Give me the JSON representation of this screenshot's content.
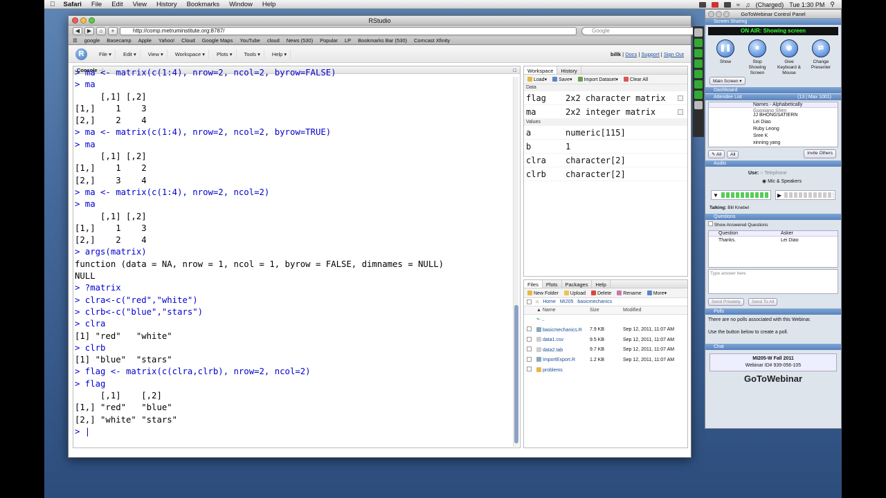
{
  "menubar": {
    "apple": "",
    "app": "Safari",
    "items": [
      "File",
      "Edit",
      "View",
      "History",
      "Bookmarks",
      "Window",
      "Help"
    ],
    "battery": "(Charged)",
    "clock": "Tue 1:30 PM"
  },
  "safari": {
    "title": "RStudio",
    "url": "http://comp.metruminstitute.org:8787/",
    "search_placeholder": "Google",
    "bookmarks": [
      "google",
      "Basecamp",
      "Apple",
      "Yahoo!",
      "Cloud",
      "Google Maps",
      "YouTube",
      "cloud",
      "News (530)",
      "Popular",
      "LP",
      "Bookmarks Bar (530)",
      "Comcast Xfinity"
    ]
  },
  "rstudio": {
    "logo": "R",
    "menus": [
      "File",
      "Edit",
      "View",
      "Workspace",
      "Plots",
      "Tools",
      "Help"
    ],
    "user": "billk",
    "links": [
      "Docs",
      "Support",
      "Sign Out"
    ],
    "console": {
      "title": "Console",
      "path": "~/",
      "lines": [
        {
          "t": "> ma <- matrix(c(1:4), nrow=2, ncol=2, byrow=FALSE)",
          "k": "cmd"
        },
        {
          "t": "> ma",
          "k": "cmd"
        },
        {
          "t": "     [,1] [,2]",
          "k": "out"
        },
        {
          "t": "[1,]    1    3",
          "k": "out"
        },
        {
          "t": "[2,]    2    4",
          "k": "out"
        },
        {
          "t": "> ma <- matrix(c(1:4), nrow=2, ncol=2, byrow=TRUE)",
          "k": "cmd"
        },
        {
          "t": "> ma",
          "k": "cmd"
        },
        {
          "t": "     [,1] [,2]",
          "k": "out"
        },
        {
          "t": "[1,]    1    2",
          "k": "out"
        },
        {
          "t": "[2,]    3    4",
          "k": "out"
        },
        {
          "t": "> ma <- matrix(c(1:4), nrow=2, ncol=2)",
          "k": "cmd"
        },
        {
          "t": "> ma",
          "k": "cmd"
        },
        {
          "t": "     [,1] [,2]",
          "k": "out"
        },
        {
          "t": "[1,]    1    3",
          "k": "out"
        },
        {
          "t": "[2,]    2    4",
          "k": "out"
        },
        {
          "t": "> args(matrix)",
          "k": "cmd"
        },
        {
          "t": "function (data = NA, nrow = 1, ncol = 1, byrow = FALSE, dimnames = NULL)",
          "k": "out"
        },
        {
          "t": "NULL",
          "k": "out"
        },
        {
          "t": "> ?matrix",
          "k": "cmd"
        },
        {
          "t": "> clra<-c(\"red\",\"white\")",
          "k": "cmd"
        },
        {
          "t": "> clrb<-c(\"blue\",\"stars\")",
          "k": "cmd"
        },
        {
          "t": "> clra",
          "k": "cmd"
        },
        {
          "t": "[1] \"red\"   \"white\"",
          "k": "out"
        },
        {
          "t": "> clrb",
          "k": "cmd"
        },
        {
          "t": "[1] \"blue\"  \"stars\"",
          "k": "out"
        },
        {
          "t": "> flag <- matrix(c(clra,clrb), nrow=2, ncol=2)",
          "k": "cmd"
        },
        {
          "t": "> flag",
          "k": "cmd"
        },
        {
          "t": "     [,1]    [,2]",
          "k": "out"
        },
        {
          "t": "[1,] \"red\"   \"blue\"",
          "k": "out"
        },
        {
          "t": "[2,] \"white\" \"stars\"",
          "k": "out"
        },
        {
          "t": "> |",
          "k": "cmd"
        }
      ]
    },
    "workspace": {
      "tabs": [
        "Workspace",
        "History"
      ],
      "toolbar": [
        "Load",
        "Save",
        "Import Dataset",
        "Clear All"
      ],
      "data_label": "Data",
      "values_label": "Values",
      "data": [
        {
          "n": "flag",
          "v": "2x2 character matrix"
        },
        {
          "n": "ma",
          "v": "2x2 integer matrix"
        }
      ],
      "values": [
        {
          "n": "a",
          "v": "numeric[115]"
        },
        {
          "n": "b",
          "v": "1"
        },
        {
          "n": "clra",
          "v": "character[2]"
        },
        {
          "n": "clrb",
          "v": "character[2]"
        }
      ]
    },
    "files": {
      "tabs": [
        "Files",
        "Plots",
        "Packages",
        "Help"
      ],
      "toolbar": [
        "New Folder",
        "Upload",
        "Delete",
        "Rename",
        "More"
      ],
      "path": [
        "Home",
        "MI205",
        "basicmechanics"
      ],
      "headers": [
        "Name",
        "Size",
        "Modified"
      ],
      "rows": [
        {
          "name": "..",
          "size": "",
          "mod": ""
        },
        {
          "name": "basicmechanics.R",
          "size": "7.9 KB",
          "mod": "Sep 12, 2011, 11:07 AM"
        },
        {
          "name": "data1.csv",
          "size": "9.5 KB",
          "mod": "Sep 12, 2011, 11:07 AM"
        },
        {
          "name": "data2.tab",
          "size": "9.7 KB",
          "mod": "Sep 12, 2011, 11:07 AM"
        },
        {
          "name": "ImportExport.R",
          "size": "1.2 KB",
          "mod": "Sep 12, 2011, 11:07 AM"
        },
        {
          "name": "problems",
          "size": "",
          "mod": ""
        }
      ]
    }
  },
  "gtw": {
    "title": "GoToWebinar Control Panel",
    "screen_sharing": "Screen Sharing",
    "on_air": "ON AIR: Showing screen",
    "buttons": [
      "Show",
      "Stop Showing Screen",
      "Give Keyboard & Mouse",
      "Change Presenter"
    ],
    "screen_select": "Main Screen",
    "dashboard": "Dashboard",
    "attendee_list": "Attendee List",
    "attendee_count": "(13 | Max 1001)",
    "attendee_header": "Names - Alphabetically",
    "attendees": [
      "Guoxiang Shen",
      "JJ BHONGSATIERN",
      "Lei Diao",
      "Ruby Leong",
      "Sree K",
      "xinning yang"
    ],
    "all_btn": "All",
    "all_btn2": "All",
    "invite": "Invite Others",
    "audio": "Audio",
    "use": "Use:",
    "telephone": "Telephone",
    "mic": "Mic & Speakers",
    "talking": "Talking:",
    "talker": "Bill Knebel",
    "questions": "Questions",
    "show_answered": "Show Answered Questions",
    "q_headers": [
      "Question",
      "Asker"
    ],
    "q_rows": [
      {
        "q": "Thanks.",
        "a": "Lei Diao"
      }
    ],
    "answer_placeholder": "Type answer here",
    "send_private": "Send Privately",
    "send_all": "Send To All",
    "polls": "Polls",
    "polls_text1": "There are no polls associated with this Webinar.",
    "polls_text2": "Use the button below to create a poll.",
    "chat": "Chat",
    "webinar_name": "MI205-W Fall 2011",
    "webinar_id": "Webinar ID# 939-056-105",
    "brand": "GoToWebinar"
  }
}
